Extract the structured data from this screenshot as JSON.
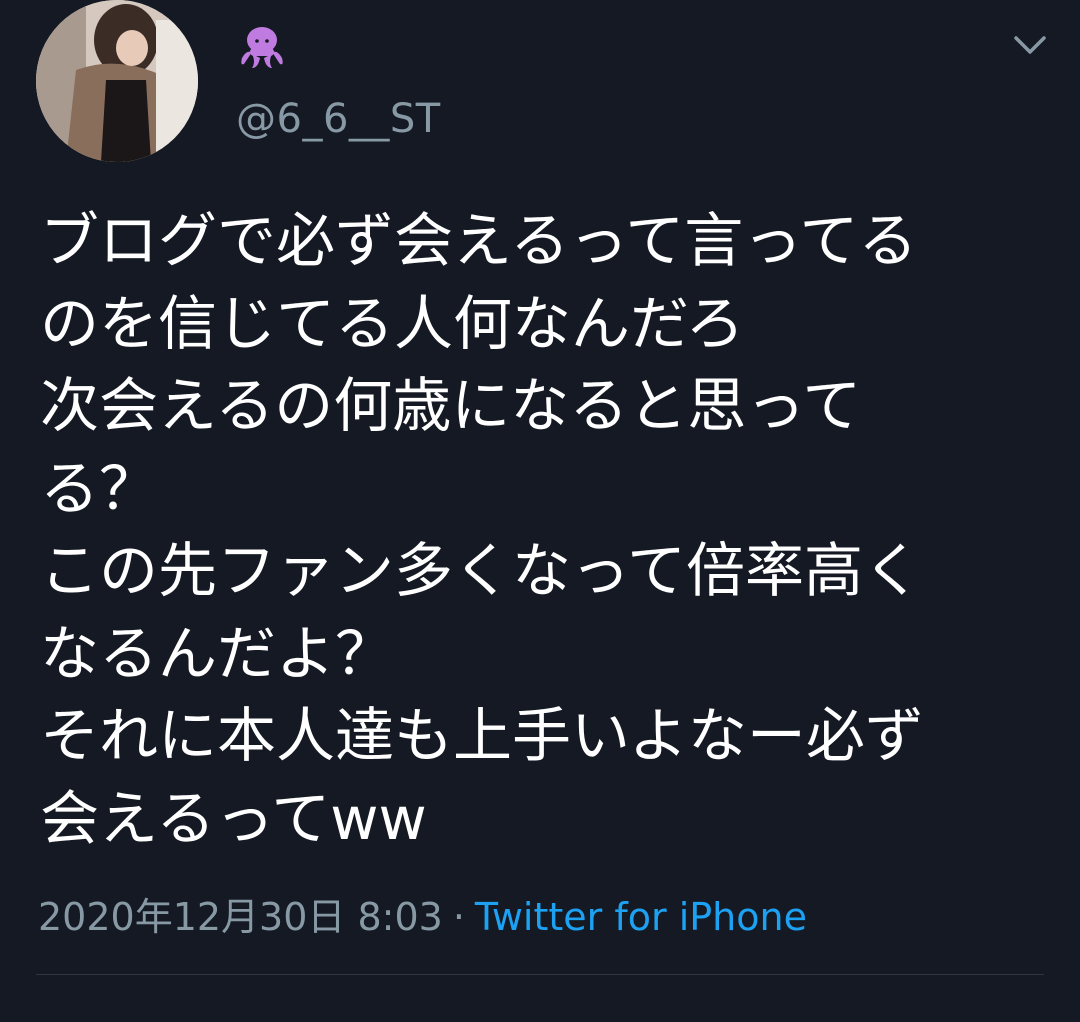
{
  "user": {
    "display_name_icon": "octopus-icon",
    "handle": "@6_6__ST"
  },
  "tweet": {
    "lines": [
      "ブログで必ず会えるって言ってる",
      "のを信じてる人何なんだろ",
      "次会えるの何歳になると思って",
      "る？",
      "この先ファン多くなって倍率高く",
      "なるんだよ？",
      "それに本人達も上手いよなー必ず",
      "会えるってww"
    ],
    "timestamp": "2020年12月30日 8:03",
    "separator": "·",
    "source": "Twitter for iPhone"
  },
  "icons": {
    "more": "chevron-down-icon"
  },
  "colors": {
    "background": "#141923",
    "secondary_text": "#8899a6",
    "link": "#1da1f2",
    "emoji": "#c07be0"
  }
}
